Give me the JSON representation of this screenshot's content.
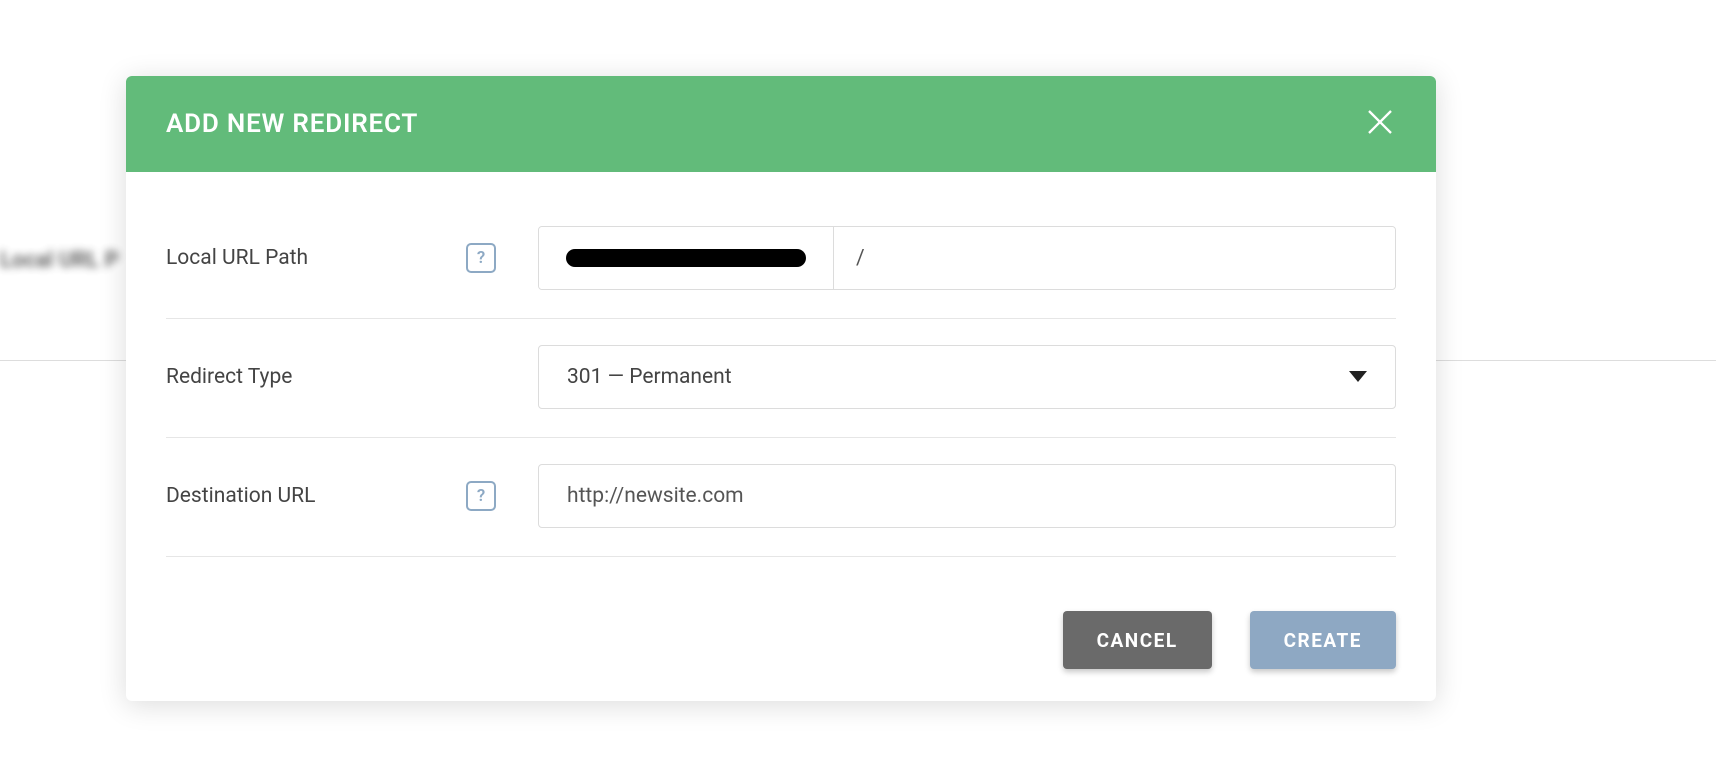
{
  "backdrop": {
    "blurred_label": "Local URL P"
  },
  "modal": {
    "title": "ADD NEW REDIRECT",
    "fields": {
      "local_url": {
        "label": "Local URL Path",
        "help_glyph": "?",
        "path_value": "/"
      },
      "redirect_type": {
        "label": "Redirect Type",
        "selected": "301 — Permanent"
      },
      "destination": {
        "label": "Destination URL",
        "help_glyph": "?",
        "value": "http://newsite.com"
      }
    },
    "buttons": {
      "cancel": "CANCEL",
      "create": "CREATE"
    }
  }
}
